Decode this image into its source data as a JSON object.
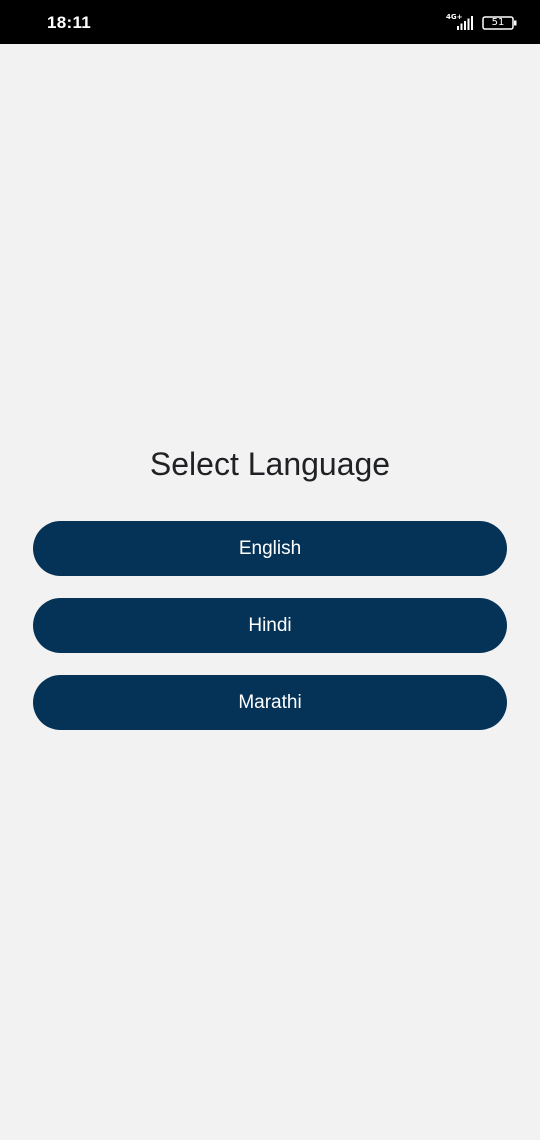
{
  "status_bar": {
    "time": "18:11",
    "network": "4G+",
    "battery": "51"
  },
  "screen": {
    "title": "Select Language",
    "languages": [
      {
        "label": "English"
      },
      {
        "label": "Hindi"
      },
      {
        "label": "Marathi"
      }
    ]
  },
  "colors": {
    "button_background": "#053357",
    "page_background": "#f2f2f2",
    "status_bar_background": "#000000"
  }
}
